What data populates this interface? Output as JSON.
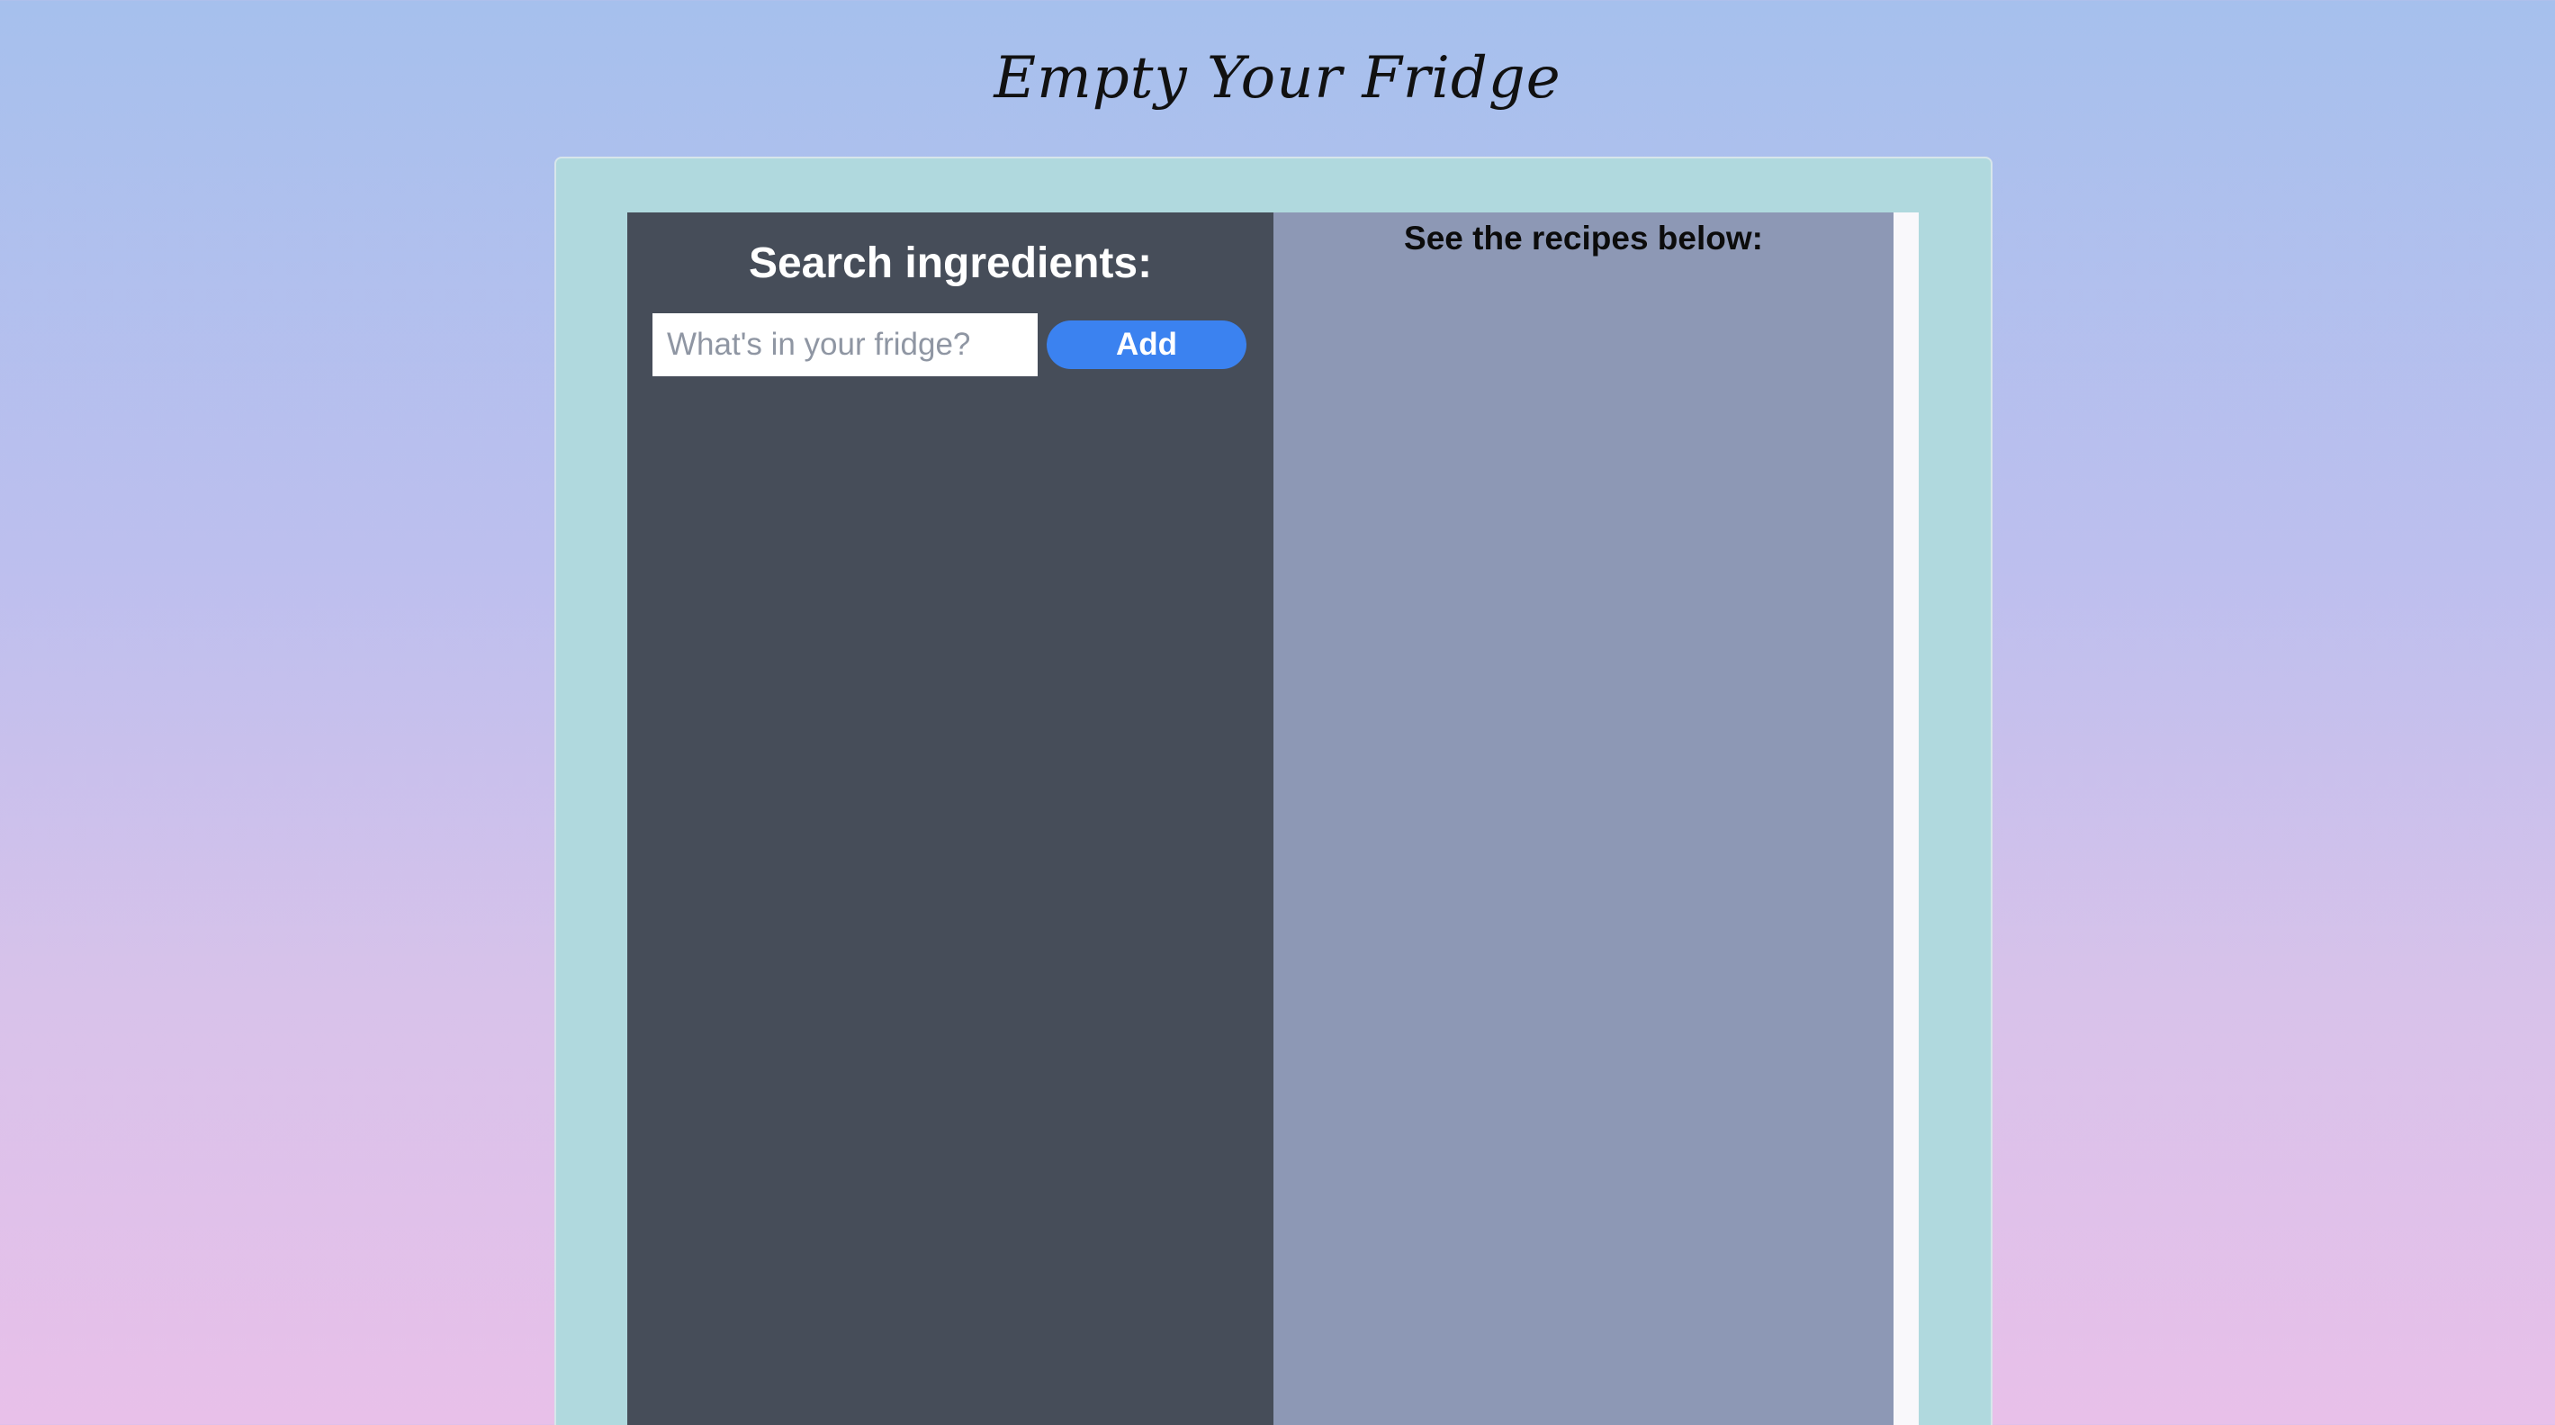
{
  "app": {
    "title": "Empty Your Fridge"
  },
  "search_panel": {
    "heading": "Search ingredients:",
    "input_placeholder": "What's in your fridge?",
    "input_value": "",
    "add_button_label": "Add"
  },
  "recipes_panel": {
    "heading": "See the recipes below:"
  },
  "colors": {
    "card_background": "#b0d9de",
    "search_panel_background": "#464d59",
    "recipes_panel_background": "#8d98b5",
    "accent_button": "#3b82f0"
  }
}
